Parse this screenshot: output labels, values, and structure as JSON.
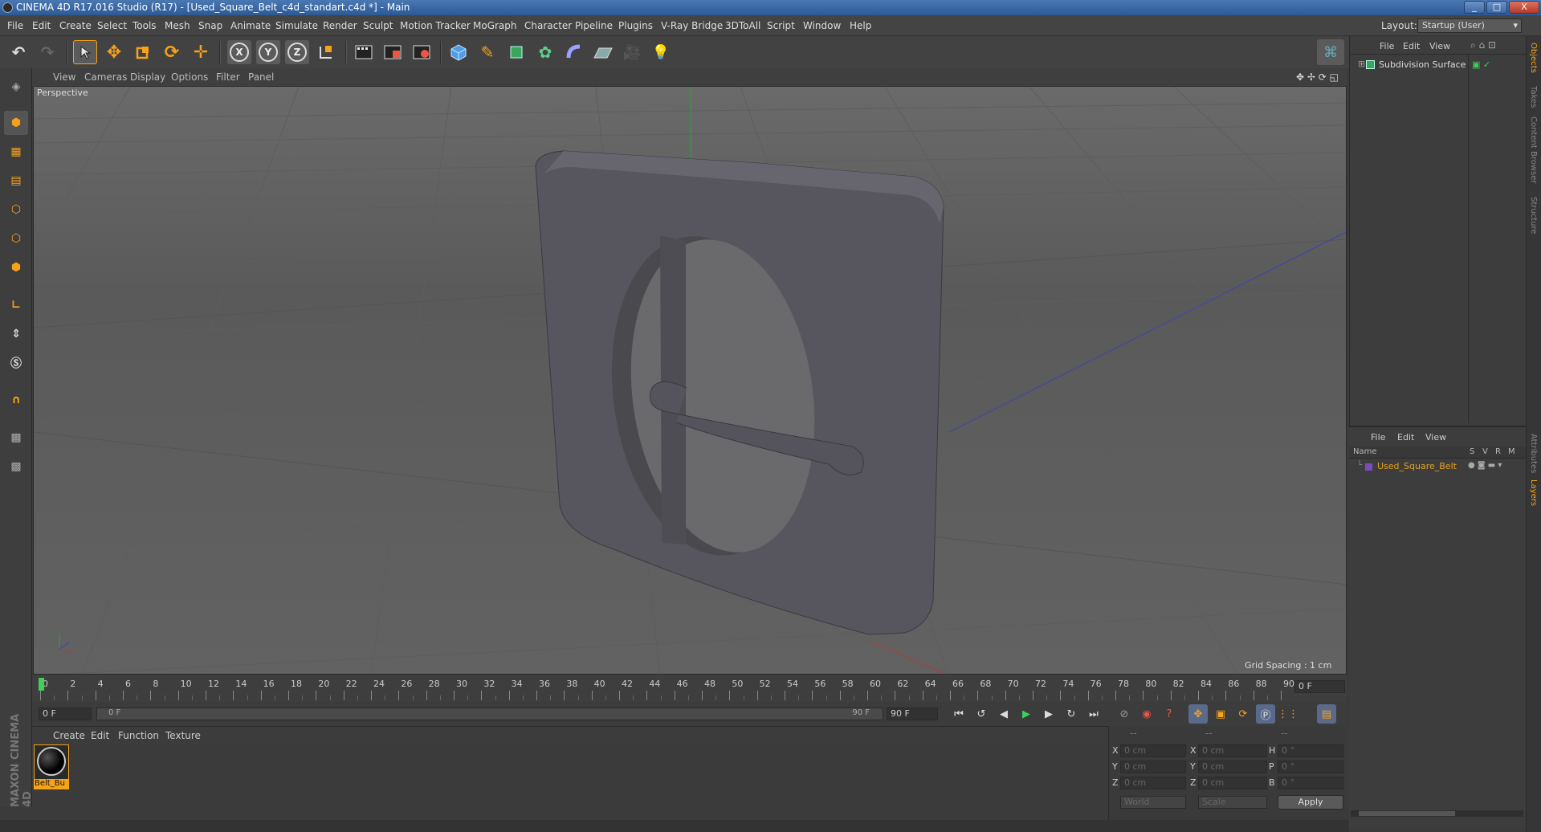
{
  "window": {
    "title": "CINEMA 4D R17.016 Studio (R17) - [Used_Square_Belt_c4d_standart.c4d *] - Main",
    "controls": [
      "_",
      "□",
      "X"
    ]
  },
  "menubar": {
    "items": [
      "File",
      "Edit",
      "Create",
      "Select",
      "Tools",
      "Mesh",
      "Snap",
      "Animate",
      "Simulate",
      "Render",
      "Sculpt",
      "Motion Tracker",
      "MoGraph",
      "Character",
      "Pipeline",
      "Plugins",
      "V-Ray Bridge",
      "3DToAll",
      "Script",
      "Window",
      "Help"
    ],
    "layout_label": "Layout:",
    "layout_value": "Startup (User)"
  },
  "toolbar": {
    "axis_x": "X",
    "axis_y": "Y",
    "axis_z": "Z",
    "accent": "#f7a21b"
  },
  "viewport": {
    "menu": [
      "View",
      "Cameras",
      "Display",
      "Options",
      "Filter",
      "Panel"
    ],
    "camera_label": "Perspective",
    "grid_spacing": "Grid Spacing : 1 cm"
  },
  "timeline": {
    "ticks": [
      "0",
      "2",
      "4",
      "6",
      "8",
      "10",
      "12",
      "14",
      "16",
      "18",
      "20",
      "22",
      "24",
      "26",
      "28",
      "30",
      "32",
      "34",
      "36",
      "38",
      "40",
      "42",
      "44",
      "46",
      "48",
      "50",
      "52",
      "54",
      "56",
      "58",
      "60",
      "62",
      "64",
      "66",
      "68",
      "70",
      "72",
      "74",
      "76",
      "78",
      "80",
      "82",
      "84",
      "86",
      "88",
      "90"
    ],
    "current_frame": "0 F"
  },
  "playbar": {
    "start_field": "0 F",
    "range_start": "0 F",
    "range_end": "90 F",
    "end_field": "90 F"
  },
  "material_manager": {
    "menu": [
      "Create",
      "Edit",
      "Function",
      "Texture"
    ],
    "material_name": "Belt_Bu"
  },
  "coordinates": {
    "header": [
      "--",
      "--",
      "--"
    ],
    "rows": [
      {
        "a": "X",
        "a_val": "0 cm",
        "b": "X",
        "b_val": "0 cm",
        "c": "H",
        "c_val": "0 °"
      },
      {
        "a": "Y",
        "a_val": "0 cm",
        "b": "Y",
        "b_val": "0 cm",
        "c": "P",
        "c_val": "0 °"
      },
      {
        "a": "Z",
        "a_val": "0 cm",
        "b": "Z",
        "b_val": "0 cm",
        "c": "B",
        "c_val": "0 °"
      }
    ],
    "space_select": "World",
    "mode_select": "Scale",
    "apply_label": "Apply"
  },
  "object_manager": {
    "menu": [
      "File",
      "Edit",
      "View"
    ],
    "object_name": "Subdivision Surface"
  },
  "layer_manager": {
    "menu": [
      "File",
      "Edit",
      "View"
    ],
    "col_name": "Name",
    "col_flags": [
      "S",
      "V",
      "R",
      "M"
    ],
    "object_name": "Used_Square_Belt",
    "object_color": "#e6a21c"
  },
  "side_tabs": [
    "Objects",
    "Takes",
    "Content Browser",
    "Structure",
    "Attributes",
    "Layers"
  ],
  "branding": "MAXON CINEMA 4D"
}
